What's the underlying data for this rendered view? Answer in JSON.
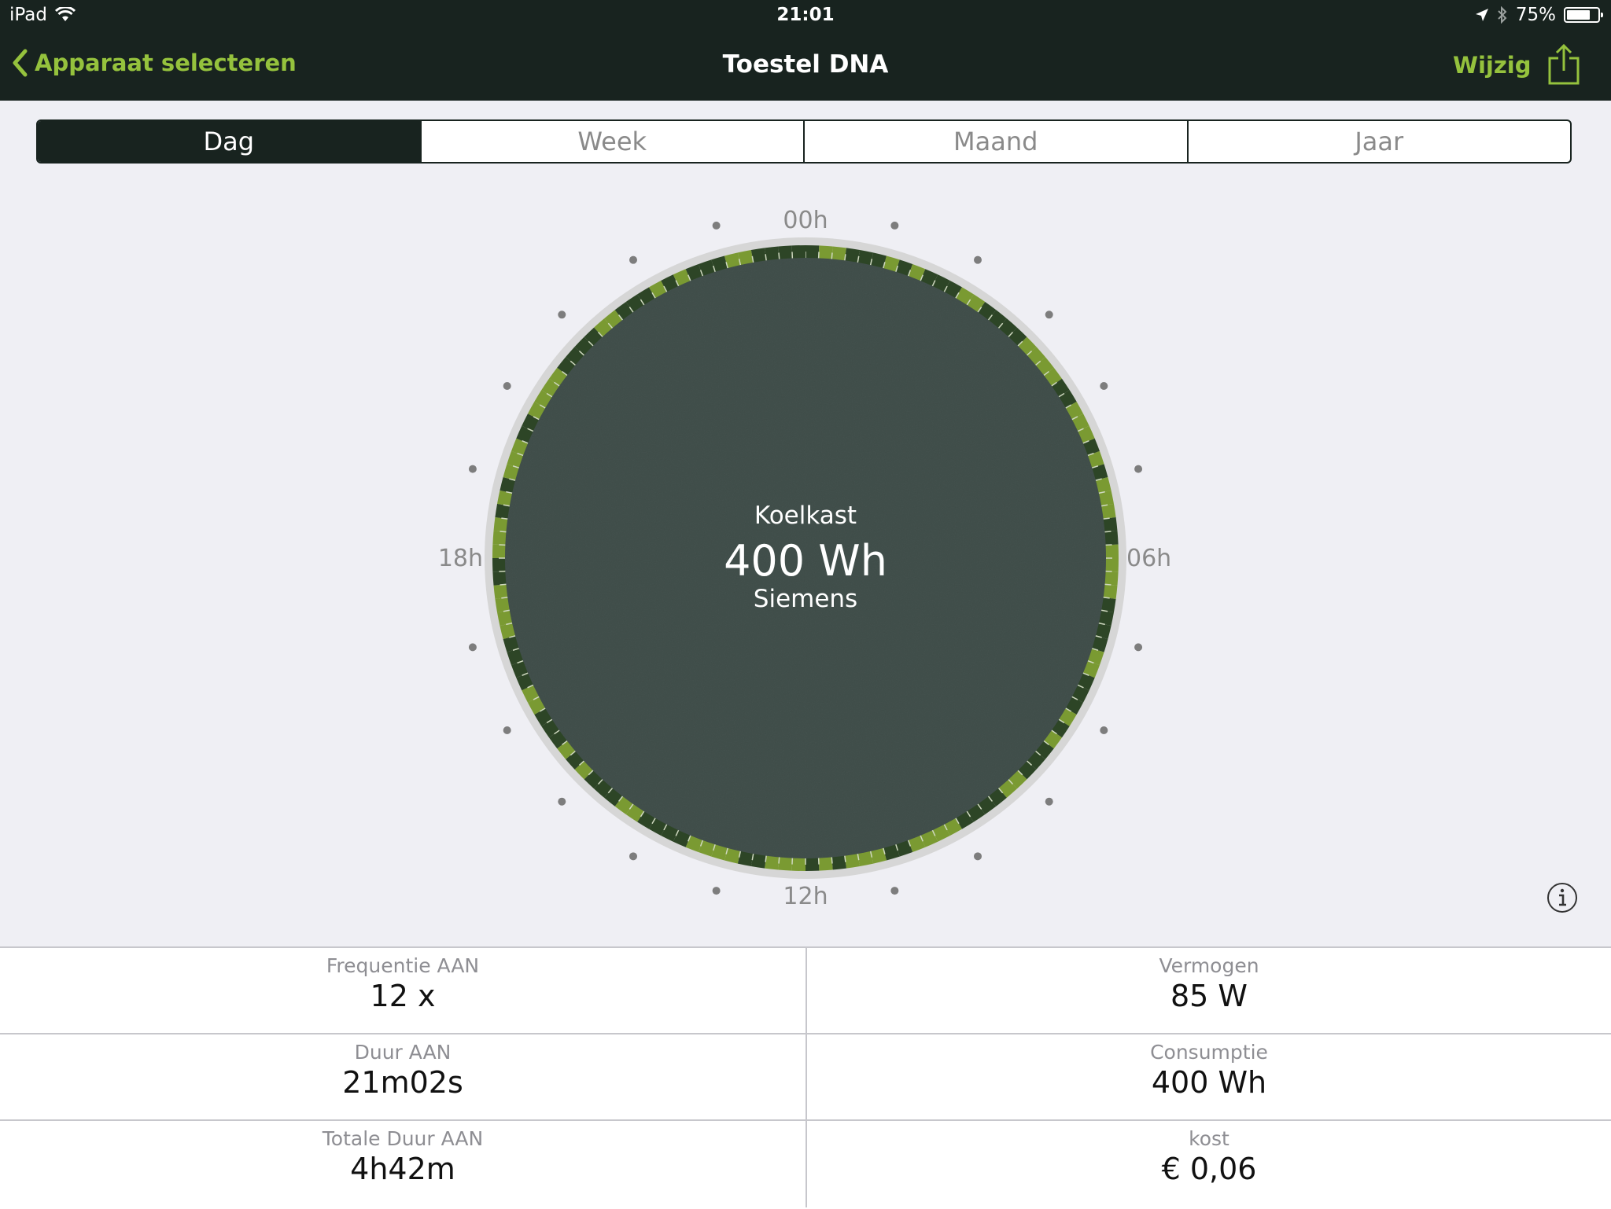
{
  "status_bar": {
    "device": "iPad",
    "time": "21:01",
    "battery": "75%",
    "battery_level": 0.75
  },
  "nav": {
    "back_label": "Apparaat selecteren",
    "title": "Toestel DNA",
    "edit_label": "Wijzig"
  },
  "tabs": [
    {
      "label": "Dag",
      "active": true
    },
    {
      "label": "Week",
      "active": false
    },
    {
      "label": "Maand",
      "active": false
    },
    {
      "label": "Jaar",
      "active": false
    }
  ],
  "clock": {
    "labels": {
      "top": "00h",
      "right": "06h",
      "bottom": "12h",
      "left": "18h"
    },
    "device_type": "Koelkast",
    "consumption": "400 Wh",
    "brand": "Siemens",
    "colors": {
      "light_green": "#7a9a32",
      "dark_green": "#2d4526",
      "face": "#3e4c48"
    }
  },
  "stats": [
    {
      "label": "Frequentie AAN",
      "value": "12 x"
    },
    {
      "label": "Vermogen",
      "value": "85 W"
    },
    {
      "label": "Duur AAN",
      "value": "21m02s"
    },
    {
      "label": "Consumptie",
      "value": "400 Wh"
    },
    {
      "label": "Totale Duur AAN",
      "value": "4h42m"
    },
    {
      "label": "kost",
      "value": "€ 0,06"
    }
  ]
}
